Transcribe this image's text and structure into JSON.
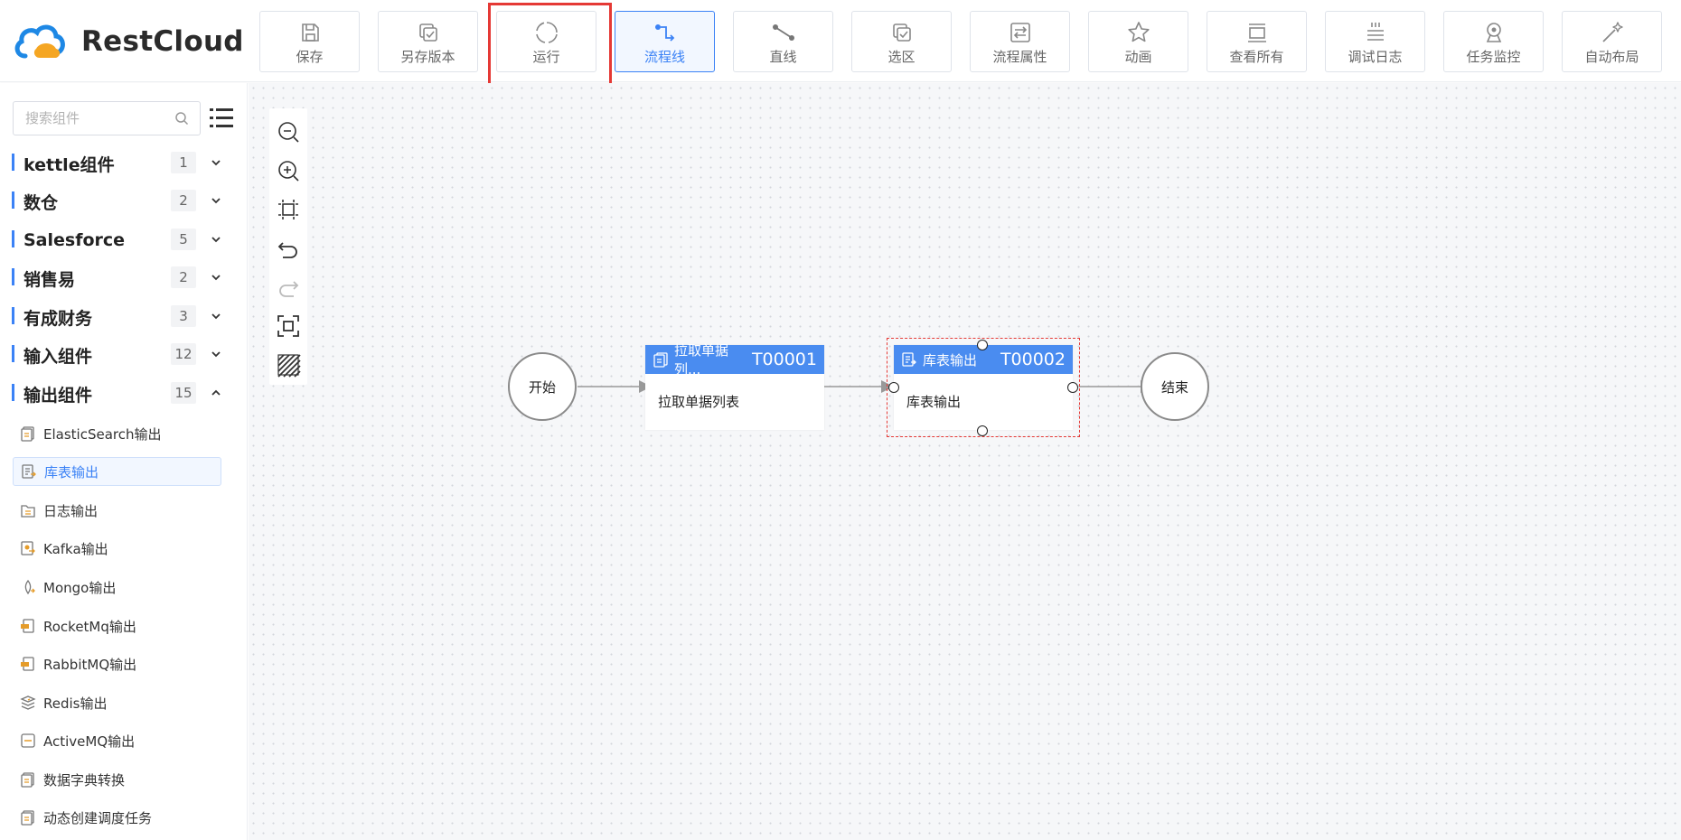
{
  "app": {
    "name": "RestCloud"
  },
  "toolbar": {
    "buttons": [
      {
        "label": "保存",
        "icon": "save-icon"
      },
      {
        "label": "另存版本",
        "icon": "copy-icon"
      },
      {
        "label": "运行",
        "icon": "loading-icon"
      },
      {
        "label": "流程线",
        "icon": "flow-line-icon",
        "active": true
      },
      {
        "label": "直线",
        "icon": "straight-line-icon"
      },
      {
        "label": "选区",
        "icon": "select-area-icon"
      },
      {
        "label": "流程属性",
        "icon": "properties-icon"
      },
      {
        "label": "动画",
        "icon": "star-icon"
      },
      {
        "label": "查看所有",
        "icon": "view-all-icon"
      },
      {
        "label": "调试日志",
        "icon": "debug-log-icon"
      },
      {
        "label": "任务监控",
        "icon": "monitor-icon"
      },
      {
        "label": "自动布局",
        "icon": "magic-wand-icon"
      }
    ]
  },
  "sidebar": {
    "search_placeholder": "搜索组件",
    "categories": [
      {
        "name": "kettle组件",
        "count": "1",
        "expanded": false
      },
      {
        "name": "数仓",
        "count": "2",
        "expanded": false
      },
      {
        "name": "Salesforce",
        "count": "5",
        "expanded": false
      },
      {
        "name": "销售易",
        "count": "2",
        "expanded": false
      },
      {
        "name": "有成财务",
        "count": "3",
        "expanded": false
      },
      {
        "name": "输入组件",
        "count": "12",
        "expanded": false
      },
      {
        "name": "输出组件",
        "count": "15",
        "expanded": true
      }
    ],
    "components": [
      {
        "name": "ElasticSearch输出",
        "icon": "document-icon"
      },
      {
        "name": "库表输出",
        "icon": "table-output-icon",
        "selected": true
      },
      {
        "name": "日志输出",
        "icon": "folder-log-icon"
      },
      {
        "name": "Kafka输出",
        "icon": "kafka-icon"
      },
      {
        "name": "Mongo输出",
        "icon": "mongo-icon"
      },
      {
        "name": "RocketMq输出",
        "icon": "rocketmq-icon"
      },
      {
        "name": "RabbitMQ输出",
        "icon": "rabbitmq-icon"
      },
      {
        "name": "Redis输出",
        "icon": "redis-icon"
      },
      {
        "name": "ActiveMQ输出",
        "icon": "activemq-icon"
      },
      {
        "name": "数据字典转换",
        "icon": "document-icon"
      },
      {
        "name": "动态创建调度任务",
        "icon": "document-icon"
      }
    ]
  },
  "canvas": {
    "zoom_tools": [
      "zoom-out-icon",
      "zoom-in-icon",
      "fit-view-icon",
      "undo-icon",
      "redo-icon",
      "actual-size-icon",
      "grid-toggle-icon"
    ],
    "nodes": {
      "start": {
        "label": "开始"
      },
      "end": {
        "label": "结束"
      },
      "node1": {
        "title": "拉取单据列...",
        "id": "T00001",
        "body": "拉取单据列表"
      },
      "node2": {
        "title": "库表输出",
        "id": "T00002",
        "body": "库表输出"
      }
    }
  },
  "colors": {
    "accent": "#3b82f6",
    "node_header": "#4a8cf0",
    "highlight": "#e53935"
  }
}
